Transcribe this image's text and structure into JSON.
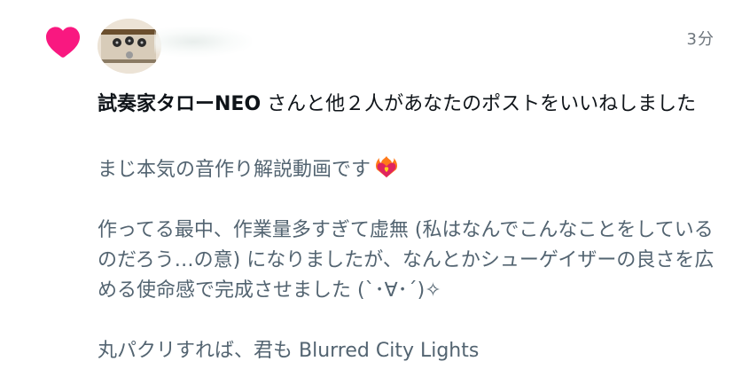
{
  "notification": {
    "icon": "heart-icon",
    "icon_color": "#f91880",
    "timestamp": "3分",
    "actor": "試奏家タローNEO",
    "message": " さんと他２人があなたのポストをいいねしました"
  },
  "post": {
    "line1": "まじ本気の音作り解説動画です",
    "line1_emoji": "heart-on-fire-icon",
    "paragraph2": "作ってる最中、作業量多すぎて虚無 (私はなんでこんなことをしているのだろう…の意) になりましたが、なんとかシューゲイザーの良さを広める使命感で完成させました (`･∀･´)✧",
    "paragraph3": "丸パクリすれば、君も Blurred City Lights"
  }
}
